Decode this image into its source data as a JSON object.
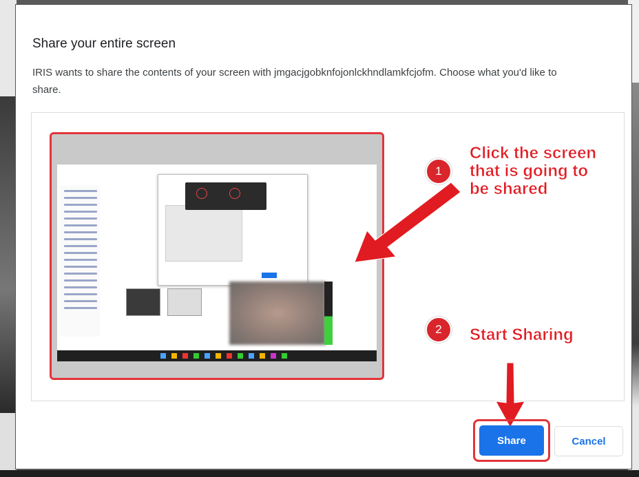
{
  "dialog": {
    "title": "Share your entire screen",
    "description": "IRIS wants to share the contents of your screen with jmgacjgobknfojonlckhndlamkfcjofm. Choose what you'd like to share."
  },
  "annotations": {
    "step1_number": "1",
    "step1_text": "Click the screen that is going to be shared",
    "step2_number": "2",
    "step2_text": "Start Sharing",
    "color": "#e11b22"
  },
  "buttons": {
    "share_label": "Share",
    "cancel_label": "Cancel"
  },
  "colors": {
    "primary": "#1a73e8",
    "highlight": "#e2343a"
  }
}
